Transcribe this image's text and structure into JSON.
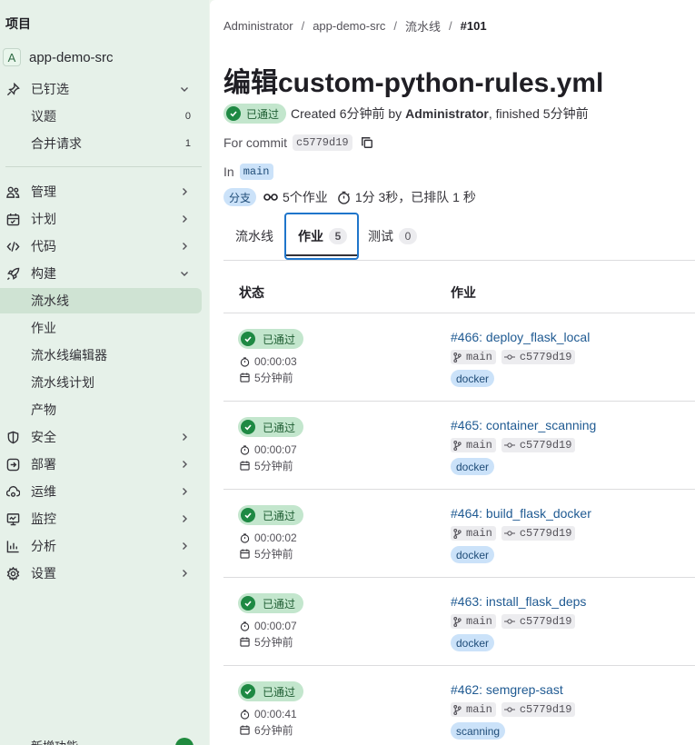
{
  "sidebar": {
    "header": "项目",
    "project": {
      "avatar": "A",
      "name": "app-demo-src"
    },
    "pinned": {
      "label": "已钉选",
      "items": [
        {
          "label": "议题",
          "count": "0"
        },
        {
          "label": "合并请求",
          "count": "1"
        }
      ]
    },
    "nav": [
      {
        "label": "管理",
        "icon": "users-icon"
      },
      {
        "label": "计划",
        "icon": "calendar-icon"
      },
      {
        "label": "代码",
        "icon": "code-icon"
      },
      {
        "label": "构建",
        "icon": "rocket-icon",
        "expanded": true
      }
    ],
    "build_sub": [
      "流水线",
      "作业",
      "流水线编辑器",
      "流水线计划",
      "产物"
    ],
    "nav2": [
      {
        "label": "安全",
        "icon": "shield-icon"
      },
      {
        "label": "部署",
        "icon": "deployments-icon"
      },
      {
        "label": "运维",
        "icon": "cloud-gear-icon"
      },
      {
        "label": "监控",
        "icon": "monitor-icon"
      },
      {
        "label": "分析",
        "icon": "chart-icon"
      },
      {
        "label": "设置",
        "icon": "gear-icon"
      }
    ],
    "bottom": "新增功能"
  },
  "breadcrumb": [
    "Administrator",
    "app-demo-src",
    "流水线",
    "#101"
  ],
  "title": "编辑custom-python-rules.yml",
  "status": {
    "badge": "已通过",
    "created": "Created 6分钟前 by",
    "author": "Administrator",
    "finished": ", finished 5分钟前"
  },
  "commit": {
    "label": "For commit",
    "sha": "c5779d19"
  },
  "ref": {
    "label": "In",
    "branch": "main"
  },
  "meta": {
    "tag": "分支",
    "jobs": "5个作业",
    "duration": "1分 3秒，已排队 1 秒"
  },
  "tabs": [
    {
      "label": "流水线"
    },
    {
      "label": "作业",
      "count": "5",
      "active": true
    },
    {
      "label": "测试",
      "count": "0"
    }
  ],
  "table": {
    "headers": {
      "status": "状态",
      "job": "作业"
    },
    "rows": [
      {
        "status": "已通过",
        "duration": "00:00:03",
        "ago": "5分钟前",
        "name": "#466: deploy_flask_local",
        "branch": "main",
        "sha": "c5779d19",
        "tag": "docker"
      },
      {
        "status": "已通过",
        "duration": "00:00:07",
        "ago": "5分钟前",
        "name": "#465: container_scanning",
        "branch": "main",
        "sha": "c5779d19",
        "tag": "docker"
      },
      {
        "status": "已通过",
        "duration": "00:00:02",
        "ago": "5分钟前",
        "name": "#464: build_flask_docker",
        "branch": "main",
        "sha": "c5779d19",
        "tag": "docker"
      },
      {
        "status": "已通过",
        "duration": "00:00:07",
        "ago": "5分钟前",
        "name": "#463: install_flask_deps",
        "branch": "main",
        "sha": "c5779d19",
        "tag": "docker"
      },
      {
        "status": "已通过",
        "duration": "00:00:41",
        "ago": "6分钟前",
        "name": "#462: semgrep-sast",
        "branch": "main",
        "sha": "c5779d19",
        "tag": "scanning"
      }
    ]
  }
}
